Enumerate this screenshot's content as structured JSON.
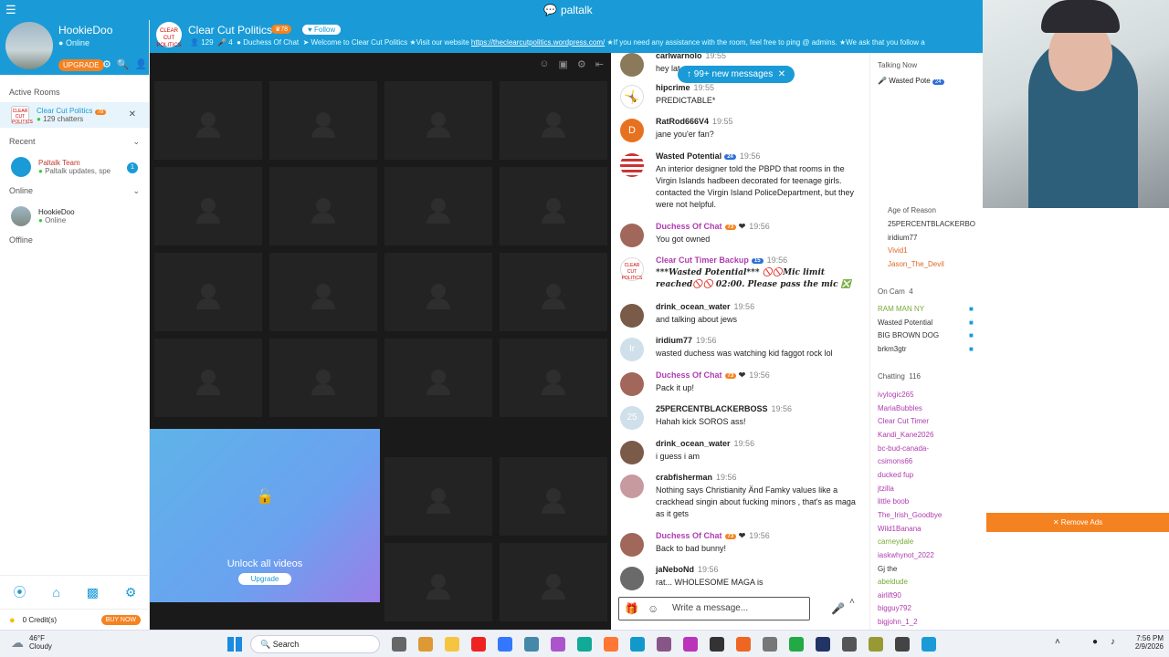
{
  "titlebar": {
    "menu_icon": "hamburger-icon",
    "brand": "paltalk"
  },
  "profile": {
    "name": "HookieDoo",
    "status": "Online",
    "upgrade": "UPGRADE"
  },
  "sidebar": {
    "active_rooms_label": "Active Rooms",
    "active_room": {
      "name": "Clear Cut Politics",
      "badge": "78",
      "chatters": "129 chatters"
    },
    "recent_label": "Recent",
    "recent_item": {
      "name": "Paltalk Team",
      "sub": "Paltalk updates, spe",
      "count": "1"
    },
    "online_label": "Online",
    "online_user": {
      "name": "HookieDoo",
      "status": "Online"
    },
    "offline_label": "Offline",
    "credits": "0 Credit(s)",
    "buy_now": "BUY NOW"
  },
  "room": {
    "title": "Clear Cut Politics",
    "badge": "78",
    "follow": "Follow",
    "users": "129",
    "mics": "4",
    "owner": "Duchess Of Chat",
    "ticker": "Welcome to Clear Cut Politics ★Visit our website",
    "link": "https://theclearcutpolitics.wordpress.com/",
    "ticker2": "★If you need any assistance with the room, feel free to ping @ admins. ★We ask that you follow a"
  },
  "video": {
    "unlock_text": "Unlock all videos",
    "upgrade": "Upgrade"
  },
  "chat": {
    "new_messages": "99+ new messages",
    "placeholder": "Write a message...",
    "messages": [
      {
        "name": "carlwarnolo",
        "time": "19:55",
        "text": "hey lat",
        "color": "#222"
      },
      {
        "name": "hipcrime",
        "time": "19:55",
        "text": "PREDICTABLE*",
        "color": "#222"
      },
      {
        "name": "RatRod666V4",
        "time": "19:55",
        "text": "jane you'er fan?",
        "color": "#222"
      },
      {
        "name": "Wasted Potential",
        "badge": "24",
        "time": "19:56",
        "text": "An interior designer told the PBPD that rooms in the Virgin Islands hadbeen decorated for teenage girls. contacted the Virgin Island PoliceDepartment, but they were not helpful.",
        "color": "#222"
      },
      {
        "name": "Duchess Of Chat",
        "badge": "73",
        "time": "19:56",
        "text": "You got owned",
        "color": "#b03cb0"
      },
      {
        "name": "Clear Cut Timer Backup",
        "badge": "15",
        "time": "19:56",
        "text": "***Wasted Potential*** 🚫🚫Mic limit reached🚫🚫 02:00. Please pass the mic ❎",
        "color": "#b03cb0"
      },
      {
        "name": "drink_ocean_water",
        "time": "19:56",
        "text": "and talking about jews",
        "color": "#222"
      },
      {
        "name": "iridium77",
        "time": "19:56",
        "text": "wasted duchess was watching kid faggot rock lol",
        "color": "#222"
      },
      {
        "name": "Duchess Of Chat",
        "badge": "73",
        "time": "19:56",
        "text": "Pack it up!",
        "color": "#b03cb0"
      },
      {
        "name": "25PERCENTBLACKERBOSS",
        "time": "19:56",
        "text": "Hahah kick SOROS ass!",
        "color": "#222"
      },
      {
        "name": "drink_ocean_water",
        "time": "19:56",
        "text": "i guess i am",
        "color": "#222"
      },
      {
        "name": "crabfisherman",
        "time": "19:56",
        "text": "Nothing says Christianity Änd Famky values like a crackhead singin about fucking minors , that's as maga as it gets",
        "color": "#222"
      },
      {
        "name": "Duchess Of Chat",
        "badge": "73",
        "time": "19:56",
        "text": "Back to bad bunny!",
        "color": "#b03cb0"
      },
      {
        "name": "jaNeboNd",
        "time": "19:56",
        "text": "rat... WHOLESOME MAGA is",
        "color": "#222"
      }
    ]
  },
  "users": {
    "talking_now": "Talking Now",
    "talking_user": "Wasted Pote",
    "talking_badge": "24",
    "age_of_reason": "Age of Reason",
    "list_a": [
      "25PERCENTBLACKERBO",
      "iridium77",
      "Vivid1",
      "Jason_The_Devil"
    ],
    "on_cam_label": "On Cam",
    "on_cam_count": "4",
    "on_cam": [
      "RAM MAN NY",
      "Wasted Potential",
      "BIG BROWN DOG",
      "brkm3gtr"
    ],
    "chatting_label": "Chatting",
    "chatting_count": "116",
    "chatting": [
      "ivylogic265",
      "MariaBubbles",
      "Clear Cut Timer",
      "Kandi_Kane2026",
      "bc-bud-canada-",
      "csimons66",
      "ducked fup",
      "jtzilla",
      "little boob",
      "The_Irish_Goodbye",
      "Wild1Banana",
      "carneydale",
      "iaskwhynot_2022",
      "Gj the",
      "abeldude",
      "airlift90",
      "bigguy792",
      "bigjohn_1_2"
    ],
    "remove_ads": "✕ Remove Ads"
  },
  "taskbar": {
    "weather_temp": "46°F",
    "weather_desc": "Cloudy",
    "search": "Search",
    "time": "7:56 PM",
    "date": "2/9/2026"
  }
}
